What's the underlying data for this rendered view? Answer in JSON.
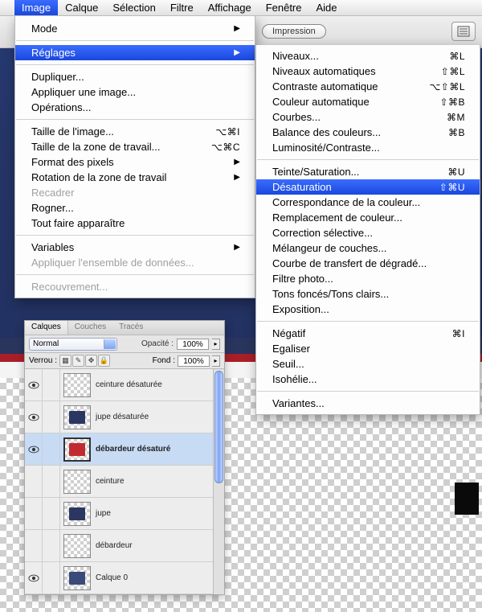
{
  "menubar": {
    "items": [
      {
        "label": "Image",
        "active": true
      },
      {
        "label": "Calque",
        "active": false
      },
      {
        "label": "Sélection",
        "active": false
      },
      {
        "label": "Filtre",
        "active": false
      },
      {
        "label": "Affichage",
        "active": false
      },
      {
        "label": "Fenêtre",
        "active": false
      },
      {
        "label": "Aide",
        "active": false
      }
    ]
  },
  "toolbar": {
    "impression_label": "Impression"
  },
  "menu_image": [
    {
      "type": "item",
      "label": "Mode",
      "submenu": true
    },
    {
      "type": "sep"
    },
    {
      "type": "item",
      "label": "Réglages",
      "submenu": true,
      "highlight": true
    },
    {
      "type": "sep"
    },
    {
      "type": "item",
      "label": "Dupliquer..."
    },
    {
      "type": "item",
      "label": "Appliquer une image..."
    },
    {
      "type": "item",
      "label": "Opérations..."
    },
    {
      "type": "sep"
    },
    {
      "type": "item",
      "label": "Taille de l'image...",
      "shortcut": "⌥⌘I"
    },
    {
      "type": "item",
      "label": "Taille de la zone de travail...",
      "shortcut": "⌥⌘C"
    },
    {
      "type": "item",
      "label": "Format des pixels",
      "submenu": true
    },
    {
      "type": "item",
      "label": "Rotation de la zone de travail",
      "submenu": true
    },
    {
      "type": "item",
      "label": "Recadrer",
      "disabled": true
    },
    {
      "type": "item",
      "label": "Rogner..."
    },
    {
      "type": "item",
      "label": "Tout faire apparaître"
    },
    {
      "type": "sep"
    },
    {
      "type": "item",
      "label": "Variables",
      "submenu": true
    },
    {
      "type": "item",
      "label": "Appliquer l'ensemble de données...",
      "disabled": true
    },
    {
      "type": "sep"
    },
    {
      "type": "item",
      "label": "Recouvrement...",
      "disabled": true
    }
  ],
  "menu_reglages": [
    {
      "type": "item",
      "label": "Niveaux...",
      "shortcut": "⌘L"
    },
    {
      "type": "item",
      "label": "Niveaux automatiques",
      "shortcut": "⇧⌘L"
    },
    {
      "type": "item",
      "label": "Contraste automatique",
      "shortcut": "⌥⇧⌘L"
    },
    {
      "type": "item",
      "label": "Couleur automatique",
      "shortcut": "⇧⌘B"
    },
    {
      "type": "item",
      "label": "Courbes...",
      "shortcut": "⌘M"
    },
    {
      "type": "item",
      "label": "Balance des couleurs...",
      "shortcut": "⌘B"
    },
    {
      "type": "item",
      "label": "Luminosité/Contraste..."
    },
    {
      "type": "sep"
    },
    {
      "type": "item",
      "label": "Teinte/Saturation...",
      "shortcut": "⌘U"
    },
    {
      "type": "item",
      "label": "Désaturation",
      "shortcut": "⇧⌘U",
      "highlight": true
    },
    {
      "type": "item",
      "label": "Correspondance de la couleur..."
    },
    {
      "type": "item",
      "label": "Remplacement de couleur..."
    },
    {
      "type": "item",
      "label": "Correction sélective..."
    },
    {
      "type": "item",
      "label": "Mélangeur de couches..."
    },
    {
      "type": "item",
      "label": "Courbe de transfert de dégradé..."
    },
    {
      "type": "item",
      "label": "Filtre photo..."
    },
    {
      "type": "item",
      "label": "Tons foncés/Tons clairs..."
    },
    {
      "type": "item",
      "label": "Exposition..."
    },
    {
      "type": "sep"
    },
    {
      "type": "item",
      "label": "Négatif",
      "shortcut": "⌘I"
    },
    {
      "type": "item",
      "label": "Egaliser"
    },
    {
      "type": "item",
      "label": "Seuil..."
    },
    {
      "type": "item",
      "label": "Isohélie..."
    },
    {
      "type": "sep"
    },
    {
      "type": "item",
      "label": "Variantes..."
    }
  ],
  "layers_panel": {
    "tabs": [
      "Calques",
      "Couches",
      "Tracés"
    ],
    "active_tab": 0,
    "blend_mode": "Normal",
    "opacity_label": "Opacité :",
    "opacity_value": "100%",
    "lock_label": "Verrou :",
    "fill_label": "Fond :",
    "fill_value": "100%",
    "layers": [
      {
        "name": "ceinture désaturée",
        "visible": true,
        "color": "transparent"
      },
      {
        "name": "jupe désaturée",
        "visible": true,
        "color": "#2b3762"
      },
      {
        "name": "débardeur désaturé",
        "visible": true,
        "color": "#c22a32",
        "selected": true
      },
      {
        "name": "ceinture",
        "visible": false,
        "color": "transparent"
      },
      {
        "name": "jupe",
        "visible": false,
        "color": "#2b3762"
      },
      {
        "name": "débardeur",
        "visible": false,
        "color": "transparent"
      },
      {
        "name": "Calque 0",
        "visible": true,
        "color": "#3a4a7a"
      }
    ]
  }
}
